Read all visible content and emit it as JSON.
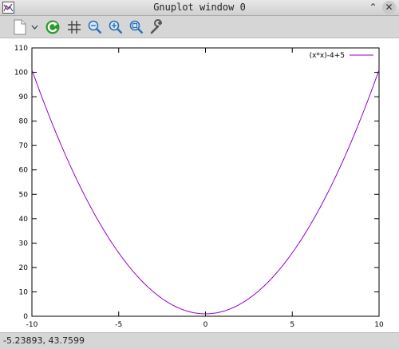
{
  "window": {
    "title": "Gnuplot window 0",
    "minimize_glyph": "⌃",
    "close_glyph": "✕"
  },
  "toolbar": {
    "icons": [
      "copy-to-clipboard-icon",
      "dropdown-arrow-icon",
      "replot-icon",
      "grid-icon",
      "zoom-previous-icon",
      "zoom-next-icon",
      "unzoom-icon",
      "settings-wrench-icon"
    ],
    "accent_green": "#2e9a2e",
    "accent_blue": "#2f6fb5"
  },
  "status": {
    "coordinates": "-5.23893,  43.7599"
  },
  "chart_data": {
    "type": "line",
    "series": [
      {
        "name": "(x*x)-4+5",
        "color": "#9400d3",
        "function": "x*x+1",
        "x": [
          -10,
          -9,
          -8,
          -7,
          -6,
          -5,
          -4,
          -3,
          -2,
          -1,
          0,
          1,
          2,
          3,
          4,
          5,
          6,
          7,
          8,
          9,
          10
        ],
        "y": [
          101,
          82,
          65,
          50,
          37,
          26,
          17,
          10,
          5,
          2,
          1,
          2,
          5,
          10,
          17,
          26,
          37,
          50,
          65,
          82,
          101
        ]
      }
    ],
    "xlim": [
      -10,
      10
    ],
    "ylim": [
      0,
      110
    ],
    "xticks": [
      -10,
      -5,
      0,
      5,
      10
    ],
    "yticks": [
      0,
      10,
      20,
      30,
      40,
      50,
      60,
      70,
      80,
      90,
      100,
      110
    ],
    "grid": false,
    "legend_position": "top-right"
  }
}
